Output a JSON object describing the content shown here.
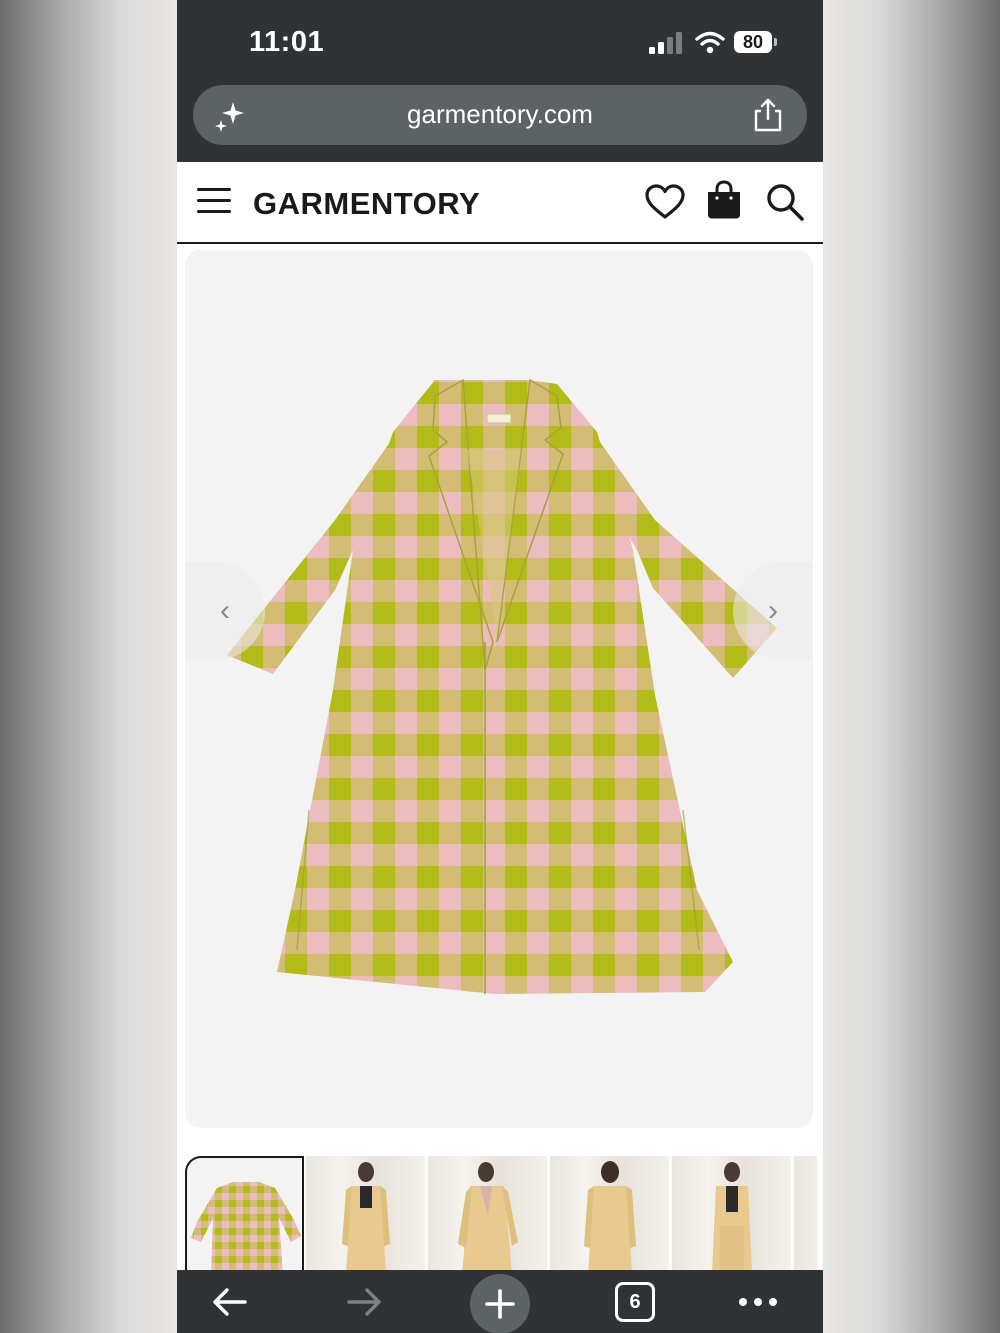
{
  "status_bar": {
    "time": "11:01",
    "battery": "80"
  },
  "browser": {
    "url": "garmentory.com",
    "tab_count": "6"
  },
  "site": {
    "logo": "GARMENTORY"
  },
  "product": {
    "image": "pink-and-green-gingham-long-coat",
    "thumbnail_count": 6
  },
  "colors": {
    "chrome": "#2f3336",
    "url_bar": "#5d6265",
    "gingham_green": "#b5bd1e",
    "gingham_pink": "#ecbcbf",
    "gingham_mix": "#cfc073"
  },
  "icons": [
    "sparkle-icon",
    "share-icon",
    "menu-icon",
    "heart-icon",
    "bag-icon",
    "search-icon",
    "chevron-left-icon",
    "chevron-right-icon",
    "back-arrow-icon",
    "forward-arrow-icon",
    "plus-icon",
    "tabs-icon",
    "more-icon"
  ]
}
